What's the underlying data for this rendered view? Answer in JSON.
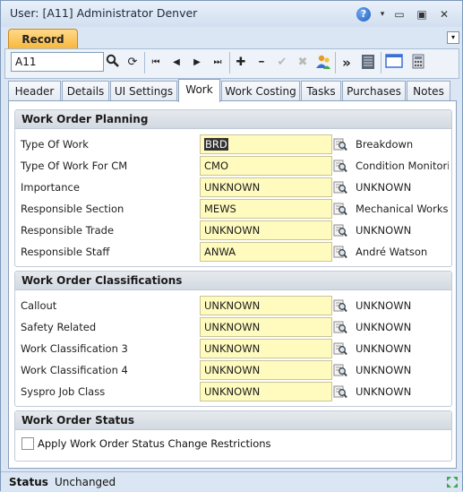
{
  "window": {
    "title": "User: [A11] Administrator Denver",
    "help_glyph": "?",
    "dropdown_glyph": "▾",
    "minimize_glyph": "▭",
    "maximize_glyph": "▣",
    "close_glyph": "✕"
  },
  "record_tab": {
    "label": "Record",
    "collapse_glyph": "▾"
  },
  "toolbar": {
    "search_value": "A11",
    "icons": [
      "search-icon",
      "refresh-icon",
      "first-record-icon",
      "previous-record-icon",
      "next-record-icon",
      "last-record-icon",
      "add-icon",
      "remove-icon",
      "confirm-icon",
      "cancel-icon",
      "user-icon",
      "more-icon",
      "list-view-icon",
      "form-view-icon",
      "calculator-icon"
    ],
    "glyphs": {
      "search": "🔍",
      "refresh": "⟳",
      "first": "⏮",
      "prev": "◀",
      "next": "▶",
      "last": "⏭",
      "add": "✚",
      "remove": "━",
      "confirm": "✔",
      "cancel": "✖",
      "more": "»"
    }
  },
  "tabs": [
    {
      "label": "Header"
    },
    {
      "label": "Details"
    },
    {
      "label": "UI Settings"
    },
    {
      "label": "Work",
      "active": true
    },
    {
      "label": "Work Costing"
    },
    {
      "label": "Tasks"
    },
    {
      "label": "Purchases"
    },
    {
      "label": "Notes"
    }
  ],
  "groups": {
    "planning": {
      "title": "Work Order Planning",
      "rows": [
        {
          "label": "Type Of Work",
          "value": "BRD",
          "desc": "Breakdown"
        },
        {
          "label": "Type Of Work For CM",
          "value": "CMO",
          "desc": "Condition Monitori"
        },
        {
          "label": "Importance",
          "value": "UNKNOWN",
          "desc": "UNKNOWN"
        },
        {
          "label": "Responsible Section",
          "value": "MEWS",
          "desc": "Mechanical Worksl"
        },
        {
          "label": "Responsible Trade",
          "value": "UNKNOWN",
          "desc": "UNKNOWN"
        },
        {
          "label": "Responsible Staff",
          "value": "ANWA",
          "desc": "André Watson"
        }
      ]
    },
    "classifications": {
      "title": "Work Order Classifications",
      "rows": [
        {
          "label": "Callout",
          "value": "UNKNOWN",
          "desc": "UNKNOWN"
        },
        {
          "label": "Safety Related",
          "value": "UNKNOWN",
          "desc": "UNKNOWN"
        },
        {
          "label": "Work Classification 3",
          "value": "UNKNOWN",
          "desc": "UNKNOWN"
        },
        {
          "label": "Work Classification 4",
          "value": "UNKNOWN",
          "desc": "UNKNOWN"
        },
        {
          "label": "Syspro Job Class",
          "value": "UNKNOWN",
          "desc": "UNKNOWN"
        }
      ]
    },
    "status": {
      "title": "Work Order Status",
      "checkbox_label": "Apply Work Order Status Change Restrictions",
      "checked": false
    }
  },
  "statusbar": {
    "label": "Status",
    "value": "Unchanged"
  },
  "colors": {
    "field_bg": "#fffbbf",
    "record_tab": "#f7b63a",
    "panel_border": "#8aa1bd"
  }
}
